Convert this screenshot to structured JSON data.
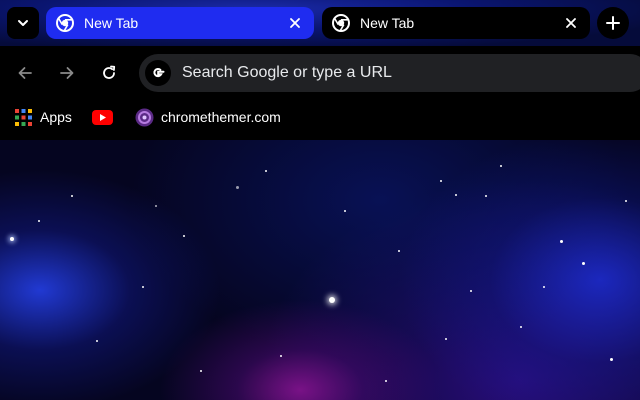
{
  "tabs": [
    {
      "title": "New Tab",
      "active": true
    },
    {
      "title": "New Tab",
      "active": false
    }
  ],
  "omnibox": {
    "placeholder": "Search Google or type a URL",
    "search_engine_icon": "google-g-icon"
  },
  "toolbar": {
    "back_icon": "arrow-left-icon",
    "forward_icon": "arrow-right-icon",
    "reload_icon": "reload-icon"
  },
  "bookmarks": [
    {
      "label": "Apps",
      "icon": "apps-grid-icon"
    },
    {
      "label": "",
      "icon": "youtube-icon"
    },
    {
      "label": "chromethemer.com",
      "icon": "chromethemer-icon"
    }
  ],
  "colors": {
    "active_tab": "#1f2cf0",
    "toolbar": "#000000",
    "omnibox": "#202124",
    "text": "#ffffff"
  }
}
